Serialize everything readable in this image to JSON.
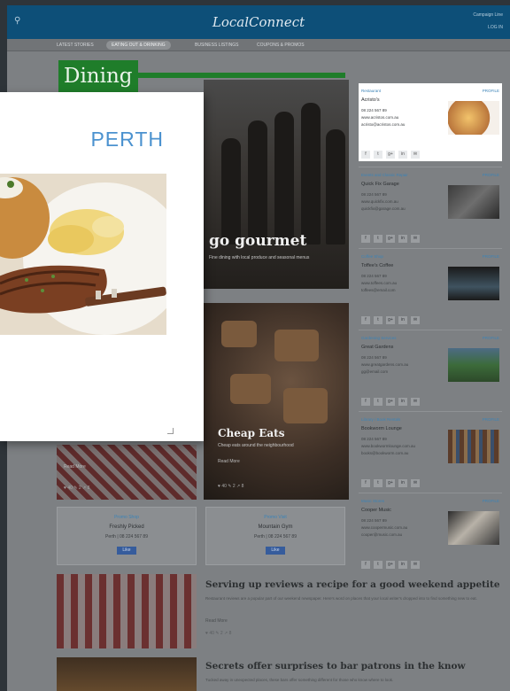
{
  "header": {
    "logo": "LocalConnect",
    "search_icon": "search-icon",
    "right_top": "Campaign Line",
    "right_bottom": "LOG IN"
  },
  "nav": {
    "tabs": [
      "LATEST STORIES",
      "EATING OUT & DRINKING",
      "BUSINESS LISTINGS",
      "COUPONS & PROMOS"
    ],
    "active_index": 1
  },
  "section": {
    "title": "Dining"
  },
  "hero": {
    "title": "go gourmet",
    "subtitle": "Fine dining with local produce and seasonal menus"
  },
  "cheap_eats": {
    "title": "Cheap Eats",
    "subtitle": "Cheap eats around the neighbourhood",
    "more": "Read More",
    "stats": "♥ 40   ✎ 2   ↗ 8"
  },
  "left_card": {
    "more": "Read More",
    "stats": "♥ 40   ✎ 2   ↗ 8"
  },
  "promos": [
    {
      "category": "Promo Shop",
      "name": "Freshly Picked",
      "location": "Perth  |  08 224 567 89",
      "like": "Like"
    },
    {
      "category": "Promo Visit",
      "name": "Mountain Gym",
      "location": "Perth  |  08 224 567 89",
      "like": "Like"
    }
  ],
  "stories": [
    {
      "title": "Serving up reviews a recipe for a good weekend appetite",
      "body": "Restaurant reviews are a popular part of our weekend newspaper. Here's word on places that your local writer's dropped into to find something new to eat.",
      "more": "Read More",
      "stats": "♥ 40   ✎ 2   ↗ 8"
    },
    {
      "title": "Secrets offer surprises to bar patrons in the know",
      "body": "Tucked away in unexpected places, these bars offer something different for those who know where to look.",
      "more": "Read More",
      "stats": ""
    }
  ],
  "businesses": [
    {
      "category": "Restaurant",
      "profile": "PROFILE",
      "name": "Acristo's",
      "phone": "08 224 567 89",
      "web": "www.acristos.com.au",
      "email": "acristo@acristos.com.au",
      "icon": "food-photo"
    },
    {
      "category": "Events and Classic Repair",
      "profile": "PROFILE",
      "name": "Quick Fix Garage",
      "phone": "08 224 567 89",
      "web": "www.quickfix.com.au",
      "email": "quickfix@garage.com.au",
      "icon": "motorbike-photo"
    },
    {
      "category": "Coffee Shop",
      "profile": "PROFILE",
      "name": "Toffee's Coffee",
      "phone": "08 224 567 89",
      "web": "www.toffees.com.au",
      "email": "toffees@email.com",
      "icon": "coffee-machine-photo"
    },
    {
      "category": "Gardening Services",
      "profile": "PROFILE",
      "name": "Great Gardens",
      "phone": "08 224 567 89",
      "web": "www.greatgardens.com.au",
      "email": "gg@email.com",
      "icon": "garden-photo"
    },
    {
      "category": "Library / Book Rentals",
      "profile": "PROFILE",
      "name": "Bookworm Lounge",
      "phone": "08 224 567 89",
      "web": "www.bookwormlounge.com.au",
      "email": "books@bookworm.com.au",
      "icon": "bookshelf-photo"
    },
    {
      "category": "Music Stores",
      "profile": "PROFILE",
      "name": "Cooper Music",
      "phone": "08 224 567 89",
      "web": "www.coopermusic.com.au",
      "email": "cooper@music.com.au",
      "icon": "guitar-photo"
    }
  ],
  "social_labels": [
    "f",
    "t",
    "g+",
    "in",
    "✉"
  ],
  "popup": {
    "city": "PERTH"
  }
}
